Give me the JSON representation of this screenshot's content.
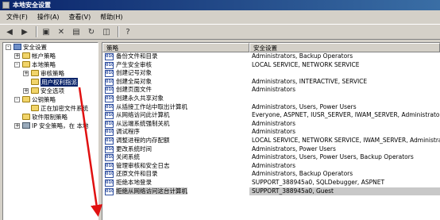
{
  "window": {
    "title": "本地安全设置"
  },
  "menu": [
    "文件(F)",
    "操作(A)",
    "查看(V)",
    "帮助(H)"
  ],
  "toolbar_icons": [
    "back-icon",
    "forward-icon",
    "up-folder-icon",
    "delete-icon",
    "properties-icon",
    "refresh-icon",
    "export-icon",
    "help-icon"
  ],
  "tree": [
    {
      "label": "安全设置",
      "indent": 0,
      "exp": "-",
      "icon": "shield"
    },
    {
      "label": "帐户策略",
      "indent": 1,
      "exp": "+",
      "icon": "folder"
    },
    {
      "label": "本地策略",
      "indent": 1,
      "exp": "-",
      "icon": "folder"
    },
    {
      "label": "审核策略",
      "indent": 2,
      "exp": "+",
      "icon": "folder"
    },
    {
      "label": "用户权利指派",
      "indent": 2,
      "exp": "",
      "icon": "folder",
      "selected": true
    },
    {
      "label": "安全选项",
      "indent": 2,
      "exp": "+",
      "icon": "folder"
    },
    {
      "label": "公钥策略",
      "indent": 1,
      "exp": "-",
      "icon": "folder"
    },
    {
      "label": "正在加密文件系统",
      "indent": 2,
      "exp": "",
      "icon": "folder"
    },
    {
      "label": "软件限制策略",
      "indent": 1,
      "exp": "",
      "icon": "folder"
    },
    {
      "label": "IP 安全策略，在 本地",
      "indent": 1,
      "exp": "+",
      "icon": "pc"
    }
  ],
  "list": {
    "headers": [
      "策略",
      "安全设置"
    ],
    "rows": [
      {
        "policy": "备份文件和目录",
        "setting": "Administrators, Backup Operators"
      },
      {
        "policy": "产生安全审核",
        "setting": "LOCAL SERVICE, NETWORK SERVICE"
      },
      {
        "policy": "创建记号对象",
        "setting": ""
      },
      {
        "policy": "创建全局对象",
        "setting": "Administrators, INTERACTIVE, SERVICE"
      },
      {
        "policy": "创建页面文件",
        "setting": "Administrators"
      },
      {
        "policy": "创建永久共享对象",
        "setting": ""
      },
      {
        "policy": "从插接工作站中取出计算机",
        "setting": "Administrators, Users, Power Users"
      },
      {
        "policy": "从网络访问此计算机",
        "setting": "Everyone, ASPNET, IUSR_SERVER, IWAM_SERVER, Administrators"
      },
      {
        "policy": "从远端系统强制关机",
        "setting": "Administrators"
      },
      {
        "policy": "调试程序",
        "setting": "Administrators"
      },
      {
        "policy": "调整进程的内存配额",
        "setting": "LOCAL SERVICE, NETWORK SERVICE, IWAM_SERVER, Administrator"
      },
      {
        "policy": "更改系统时间",
        "setting": "Administrators, Power Users"
      },
      {
        "policy": "关闭系统",
        "setting": "Administrators, Users, Power Users, Backup Operators"
      },
      {
        "policy": "管理审核和安全日志",
        "setting": "Administrators"
      },
      {
        "policy": "还原文件和目录",
        "setting": "Administrators, Backup Operators"
      },
      {
        "policy": "拒绝本地登录",
        "setting": "SUPPORT_388945a0, SQLDebugger, ASPNET"
      },
      {
        "policy": "拒绝从网络访问这台计算机",
        "setting": "SUPPORT_388945a0, Guest",
        "highlight": true
      }
    ]
  },
  "colors": {
    "annotation_arrow": "#e01010"
  }
}
